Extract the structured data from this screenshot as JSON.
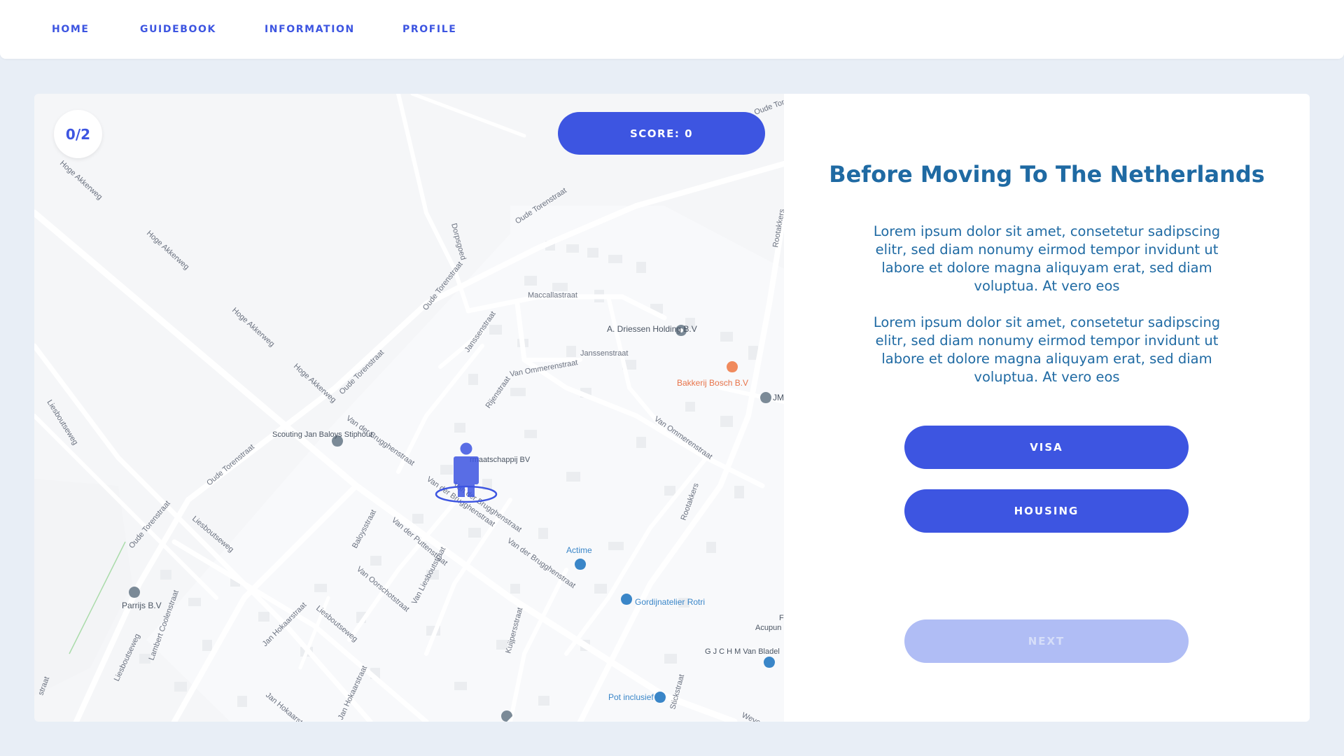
{
  "nav": {
    "items": [
      {
        "label": "HOME"
      },
      {
        "label": "GUIDEBOOK"
      },
      {
        "label": "INFORMATION"
      },
      {
        "label": "PROFILE"
      }
    ]
  },
  "game": {
    "counter": "0/2",
    "score_label": "SCORE: 0"
  },
  "map": {
    "streets": [
      "Oude Torenstraat",
      "Oude Torenstraat",
      "Oude Torenstraat",
      "Oude Torenstraat",
      "Hoge Akkerweg",
      "Hoge Akkerweg",
      "Hoge Akkerweg",
      "Hoge Akkerweg",
      "Dorpsgoed",
      "Maccallastraat",
      "Janssenstraat",
      "Janssenstraat",
      "Van Ommerenstraat",
      "Van Ommerenstraat",
      "Rijenstraat",
      "Van der Brugghenstraat",
      "Van der Brugghenstraat",
      "Van der Brugghenstraat",
      "Van der Brugghenstraat",
      "Liesboutseweg",
      "Liesboutseweg",
      "Liesboutseweg",
      "Liesboutseweg",
      "Baloysstraat",
      "Van der Puttenstraat",
      "Van Oorschotstraat",
      "Van Liesboutstraat",
      "Rootakkers",
      "Rootakkers",
      "Jan Hokaarstraat",
      "Jan Hokaarstraat",
      "Jan Hokaarstraat",
      "Lambert Coolenstraat",
      "Oude Torenstraat",
      "Kuijpersstraat",
      "Oude Tore",
      "Weve",
      "Stickstraat",
      "straat"
    ],
    "pois": [
      {
        "name": "A. Driessen Holding B.V",
        "color": "#5f6f7f"
      },
      {
        "name": "Bakkerij Bosch B.V",
        "color": "#e8744a"
      },
      {
        "name": "JM",
        "color": "#5f6f7f"
      },
      {
        "name": "Scouting Jan Baloys Stiphout",
        "color": "#5f6f7f"
      },
      {
        "name": "rmaatschappij BV",
        "color": "#5f6f7f"
      },
      {
        "name": "Actime",
        "color": "#3a86c8"
      },
      {
        "name": "Gordijnatelier Rotri",
        "color": "#3a86c8"
      },
      {
        "name": "Acupun",
        "color": "#5f6f7f"
      },
      {
        "name": "G J C H M Van Bladel",
        "color": "#5f6f7f"
      },
      {
        "name": "Parrijs B.V",
        "color": "#5f6f7f"
      },
      {
        "name": "Pot inclusief",
        "color": "#3a86c8"
      },
      {
        "name": "F",
        "color": "#5f6f7f"
      }
    ]
  },
  "info": {
    "title": "Before Moving To The Netherlands",
    "paragraphs": [
      "Lorem ipsum dolor sit amet, consetetur sadipscing elitr, sed diam nonumy eirmod tempor invidunt ut labore et dolore magna aliquyam erat, sed diam voluptua. At vero eos",
      "Lorem ipsum dolor sit amet, consetetur sadipscing elitr, sed diam nonumy eirmod tempor invidunt ut labore et dolore magna aliquyam erat, sed diam voluptua. At vero eos"
    ],
    "buttons": {
      "visa": "VISA",
      "housing": "HOUSING",
      "next": "NEXT"
    }
  },
  "colors": {
    "accent": "#3d55e1",
    "accent_disabled": "#b0bdf5",
    "title": "#1f6aa3",
    "background": "#e8eef6"
  }
}
